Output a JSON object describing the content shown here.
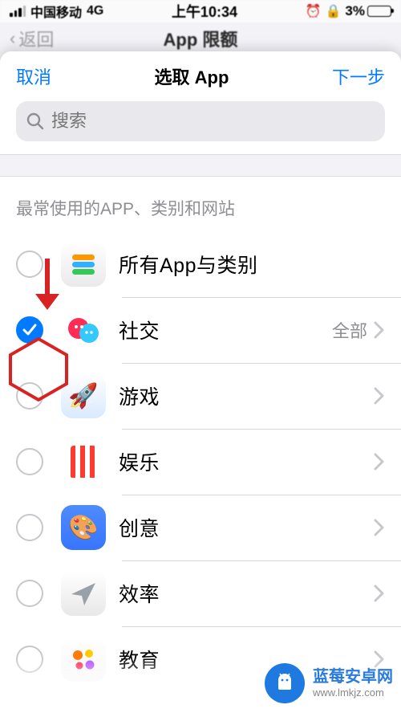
{
  "status_bar": {
    "carrier": "中国移动",
    "network": "4G",
    "time": "上午10:34",
    "alarm_icon": "alarm-icon",
    "orientation_icon": "orientation-lock-icon",
    "battery_percent": "3%"
  },
  "prev_header": {
    "back": "返回",
    "title": "App 限额"
  },
  "sheet": {
    "cancel": "取消",
    "title": "选取 App",
    "next": "下一步",
    "search_placeholder": "搜索"
  },
  "section_title": "最常使用的APP、类别和网站",
  "rows": [
    {
      "label": "所有App与类别",
      "checked": false,
      "has_chevron": false,
      "icon": "stack-icon",
      "trail": ""
    },
    {
      "label": "社交",
      "checked": true,
      "has_chevron": true,
      "icon": "chat-icon",
      "trail": "全部"
    },
    {
      "label": "游戏",
      "checked": false,
      "has_chevron": true,
      "icon": "rocket-icon",
      "trail": ""
    },
    {
      "label": "娱乐",
      "checked": false,
      "has_chevron": true,
      "icon": "popcorn-icon",
      "trail": ""
    },
    {
      "label": "创意",
      "checked": false,
      "has_chevron": true,
      "icon": "palette-icon",
      "trail": ""
    },
    {
      "label": "效率",
      "checked": false,
      "has_chevron": true,
      "icon": "paperplane-icon",
      "trail": ""
    },
    {
      "label": "教育",
      "checked": false,
      "has_chevron": true,
      "icon": "dots-icon",
      "trail": ""
    }
  ],
  "watermark": {
    "title": "蓝莓安卓网",
    "url": "www.lmkjz.com"
  },
  "colors": {
    "accent": "#007aff",
    "annotation": "#d72323",
    "battery_low": "#ff3b30"
  }
}
